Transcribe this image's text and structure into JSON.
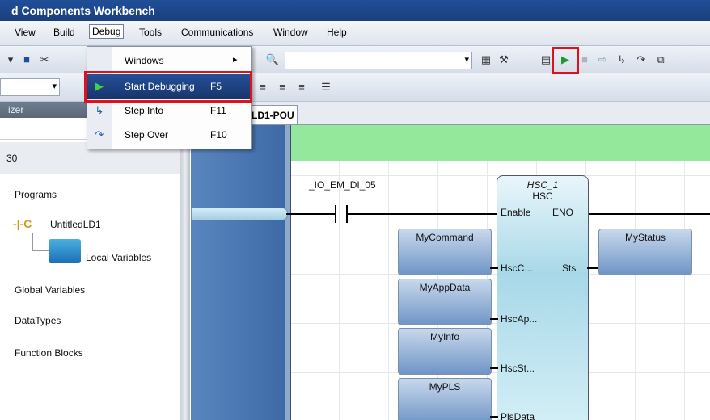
{
  "window": {
    "title": "d Components Workbench"
  },
  "menubar": {
    "items": [
      {
        "label": "View"
      },
      {
        "label": "Build"
      },
      {
        "label": "Debug"
      },
      {
        "label": "Tools"
      },
      {
        "label": "Communications"
      },
      {
        "label": "Window"
      },
      {
        "label": "Help"
      }
    ]
  },
  "debug_menu": {
    "windows": {
      "label": "Windows",
      "submenu_arrow": "▸"
    },
    "start_debugging": {
      "label": "Start Debugging",
      "shortcut": "F5"
    },
    "step_into": {
      "label": "Step Into",
      "shortcut": "F11"
    },
    "step_over": {
      "label": "Step Over",
      "shortcut": "F10"
    }
  },
  "left_panel": {
    "header": "izer",
    "tree": {
      "node_30": "30",
      "programs": "Programs",
      "untitled_ld1": "UntitledLD1",
      "local_variables": "Local Variables",
      "global_variables": "Global Variables",
      "datatypes": "DataTypes",
      "function_blocks": "Function Blocks"
    }
  },
  "editor": {
    "tab_label": "LD1-POU",
    "contact_label": "_IO_EM_DI_05",
    "block": {
      "instance": "HSC_1",
      "type": "HSC",
      "pins": {
        "enable": "Enable",
        "eno": "ENO",
        "hscc": "HscC...",
        "sts": "Sts",
        "hscap": "HscAp...",
        "hscst": "HscSt...",
        "plsdata": "PlsData"
      }
    },
    "variables": {
      "mycommand": "MyCommand",
      "myappdata": "MyAppData",
      "myinfo": "MyInfo",
      "mypls": "MyPLS",
      "mystatus": "MyStatus"
    }
  },
  "colors": {
    "highlight_red": "#e3101a",
    "menu_highlight": "#1f4a8e",
    "green_header": "#93e89b",
    "rail_blue": "#3d6aa6"
  }
}
